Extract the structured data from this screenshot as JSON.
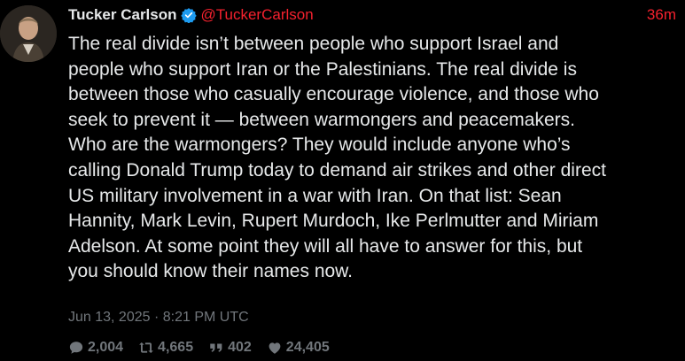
{
  "author": {
    "display_name": "Tucker Carlson",
    "handle": "@TuckerCarlson",
    "verified": true,
    "time_ago": "36m"
  },
  "tweet": {
    "text": "The real divide isn’t between people who support Israel and\npeople who support Iran or the Palestinians. The real divide is\nbetween those who casually encourage violence, and those who\nseek to prevent it — between warmongers and peacemakers.\nWho are the warmongers? They would include anyone who’s\ncalling Donald Trump today to demand air strikes and other direct\nUS military involvement in a war with Iran. On that list: Sean\nHannity, Mark Levin, Rupert Murdoch, Ike Perlmutter and Miriam\nAdelson. At some point they will all have to answer for this, but\nyou should know their names now.",
    "timestamp": "Jun 13, 2025 · 8:21 PM UTC"
  },
  "stats": {
    "replies": "2,004",
    "retweets": "4,665",
    "quotes": "402",
    "likes": "24,405"
  },
  "colors": {
    "background": "#000000",
    "text": "#e7e9ea",
    "accent": "#f4212e",
    "muted": "#71767b",
    "verified": "#1d9bf0"
  },
  "icons": {
    "verified": "verified-badge-icon",
    "replies": "comment-icon",
    "retweets": "retweet-icon",
    "quotes": "quote-icon",
    "likes": "heart-icon"
  }
}
